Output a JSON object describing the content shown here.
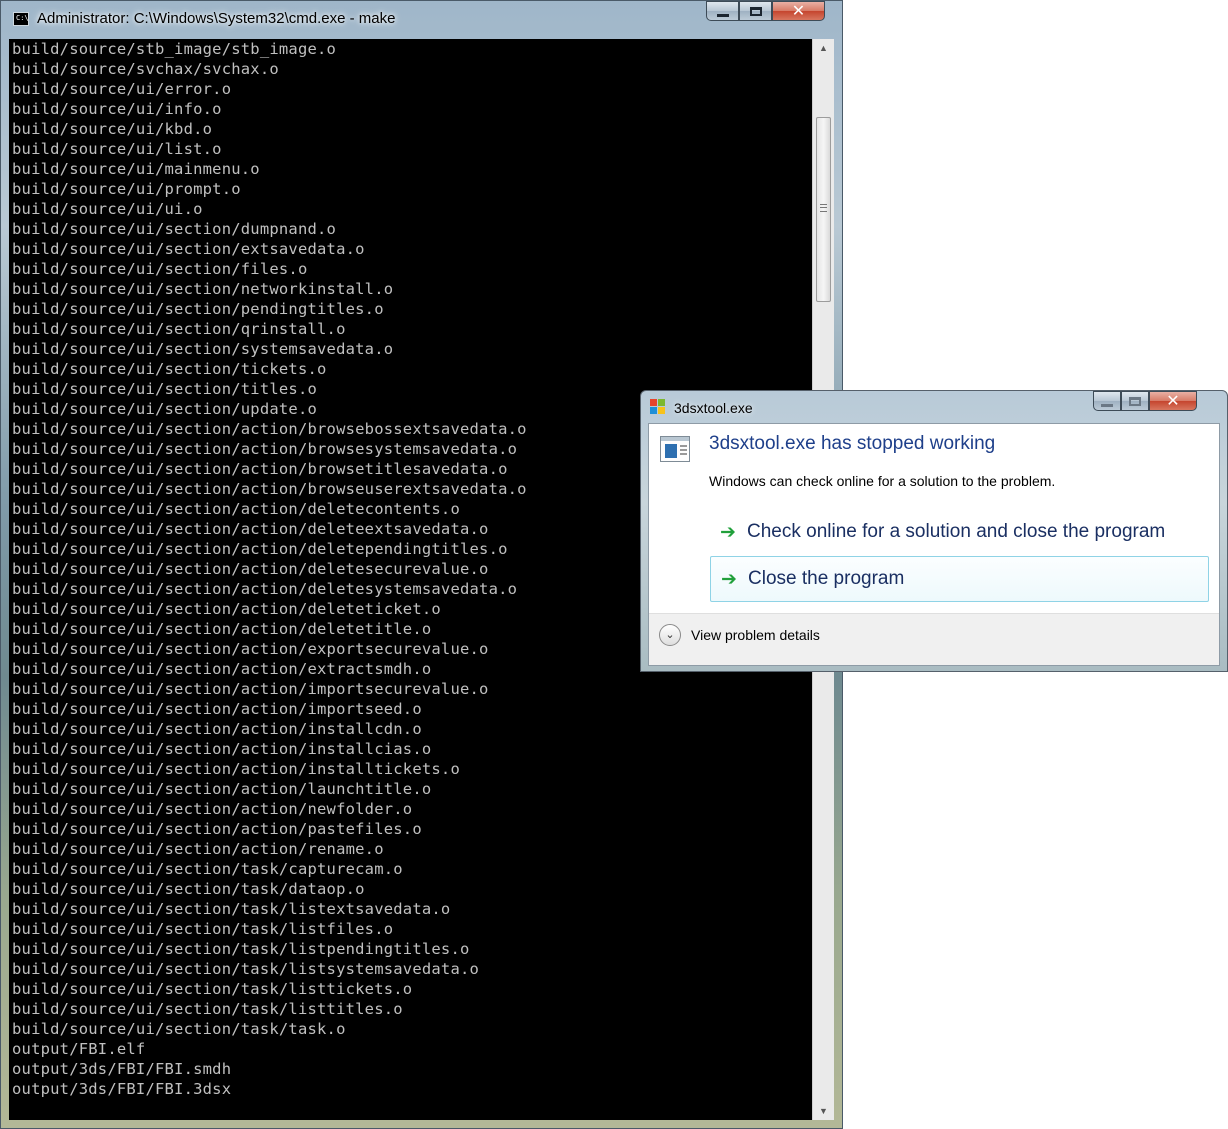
{
  "cmd": {
    "title": "Administrator: C:\\Windows\\System32\\cmd.exe - make",
    "icon_label": "C:\\",
    "lines": [
      "build/source/stb_image/stb_image.o",
      "build/source/svchax/svchax.o",
      "build/source/ui/error.o",
      "build/source/ui/info.o",
      "build/source/ui/kbd.o",
      "build/source/ui/list.o",
      "build/source/ui/mainmenu.o",
      "build/source/ui/prompt.o",
      "build/source/ui/ui.o",
      "build/source/ui/section/dumpnand.o",
      "build/source/ui/section/extsavedata.o",
      "build/source/ui/section/files.o",
      "build/source/ui/section/networkinstall.o",
      "build/source/ui/section/pendingtitles.o",
      "build/source/ui/section/qrinstall.o",
      "build/source/ui/section/systemsavedata.o",
      "build/source/ui/section/tickets.o",
      "build/source/ui/section/titles.o",
      "build/source/ui/section/update.o",
      "build/source/ui/section/action/browsebossextsavedata.o",
      "build/source/ui/section/action/browsesystemsavedata.o",
      "build/source/ui/section/action/browsetitlesavedata.o",
      "build/source/ui/section/action/browseuserextsavedata.o",
      "build/source/ui/section/action/deletecontents.o",
      "build/source/ui/section/action/deleteextsavedata.o",
      "build/source/ui/section/action/deletependingtitles.o",
      "build/source/ui/section/action/deletesecurevalue.o",
      "build/source/ui/section/action/deletesystemsavedata.o",
      "build/source/ui/section/action/deleteticket.o",
      "build/source/ui/section/action/deletetitle.o",
      "build/source/ui/section/action/exportsecurevalue.o",
      "build/source/ui/section/action/extractsmdh.o",
      "build/source/ui/section/action/importsecurevalue.o",
      "build/source/ui/section/action/importseed.o",
      "build/source/ui/section/action/installcdn.o",
      "build/source/ui/section/action/installcias.o",
      "build/source/ui/section/action/installtickets.o",
      "build/source/ui/section/action/launchtitle.o",
      "build/source/ui/section/action/newfolder.o",
      "build/source/ui/section/action/pastefiles.o",
      "build/source/ui/section/action/rename.o",
      "build/source/ui/section/task/capturecam.o",
      "build/source/ui/section/task/dataop.o",
      "build/source/ui/section/task/listextsavedata.o",
      "build/source/ui/section/task/listfiles.o",
      "build/source/ui/section/task/listpendingtitles.o",
      "build/source/ui/section/task/listsystemsavedata.o",
      "build/source/ui/section/task/listtickets.o",
      "build/source/ui/section/task/listtitles.o",
      "build/source/ui/section/task/task.o",
      "output/FBI.elf",
      "output/3ds/FBI/FBI.smdh",
      "output/3ds/FBI/FBI.3dsx"
    ]
  },
  "dialog": {
    "title": "3dsxtool.exe",
    "heading": "3dsxtool.exe has stopped working",
    "subtext": "Windows can check online for a solution to the problem.",
    "options": [
      "Check online for a solution and close the program",
      "Close the program"
    ],
    "details_label": "View problem details"
  },
  "icons": {
    "window_minimize": "minimize-icon",
    "window_maximize": "maximize-icon",
    "window_close": "close-icon",
    "option_arrow": "green-arrow-icon",
    "details_toggle": "chevron-down-icon"
  },
  "colors": {
    "console_bg": "#000000",
    "console_text": "#c0c0c0",
    "dialog_heading": "#1e3f8a",
    "option_arrow": "#21a03b",
    "selected_option_border": "#8fd3e6"
  }
}
